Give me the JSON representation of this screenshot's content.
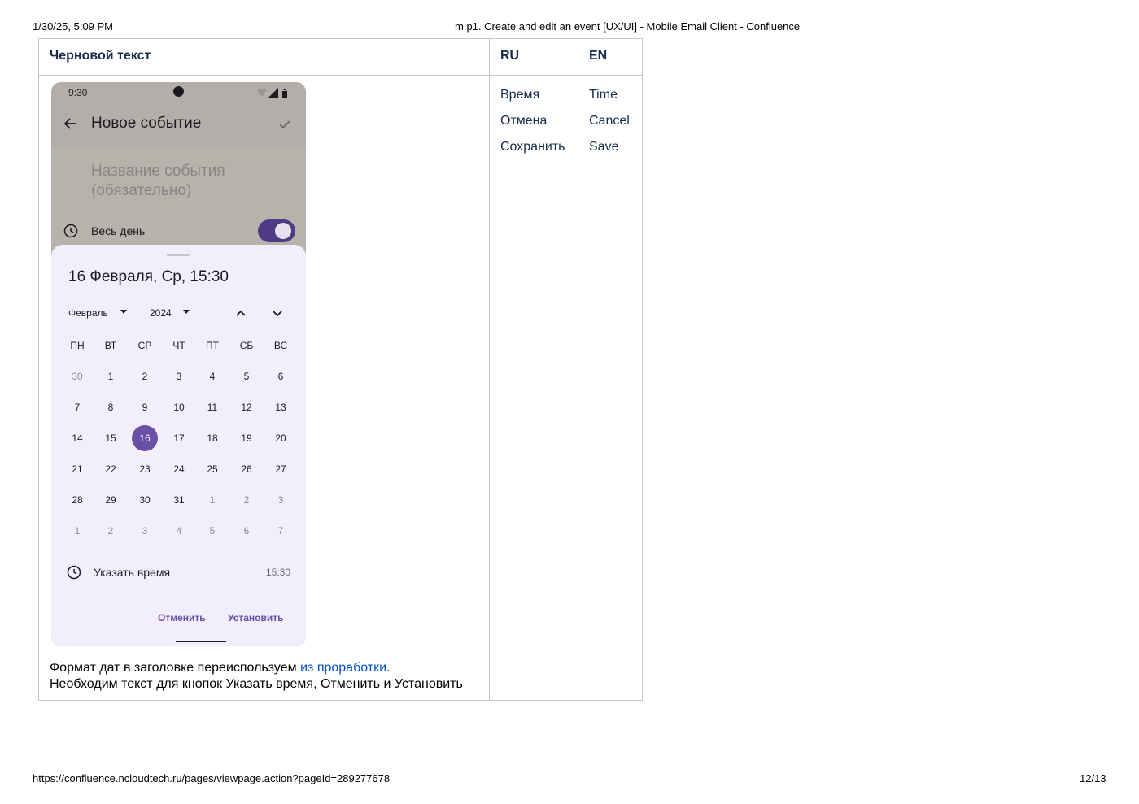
{
  "print_header": {
    "datetime": "1/30/25, 5:09 PM",
    "page_title": "m.p1. Create and edit an event [UX/UI] - Mobile Email Client - Confluence"
  },
  "print_footer": {
    "url": "https://confluence.ncloudtech.ru/pages/viewpage.action?pageId=289277678",
    "page_number": "12/13"
  },
  "table": {
    "headers": {
      "draft": "Черновой текст",
      "ru": "RU",
      "en": "EN"
    },
    "ru_terms": [
      "Время",
      "Отмена",
      "Сохранить"
    ],
    "en_terms": [
      "Time",
      "Cancel",
      "Save"
    ],
    "note_line1_prefix": "Формат дат в заголовке переиспользуем ",
    "note_link": "из проработки",
    "note_line1_suffix": ".",
    "note_line2": "Необходим текст для кнопок Указать время, Отменить и Установить"
  },
  "phone": {
    "status_time": "9:30",
    "appbar_title": "Новое событие",
    "event_name_placeholder": "Название события (обязательно)",
    "all_day_label": "Весь день",
    "all_day_enabled": true,
    "selected_date_header": "16 Февраля, Ср, 15:30",
    "month": "Февраль",
    "year": "2024",
    "weekdays": [
      "ПН",
      "ВТ",
      "СР",
      "ЧТ",
      "ПТ",
      "СБ",
      "ВС"
    ],
    "weeks": [
      [
        "30",
        "1",
        "2",
        "3",
        "4",
        "5",
        "6"
      ],
      [
        "7",
        "8",
        "9",
        "10",
        "11",
        "12",
        "13"
      ],
      [
        "14",
        "15",
        "16",
        "17",
        "18",
        "19",
        "20"
      ],
      [
        "21",
        "22",
        "23",
        "24",
        "25",
        "26",
        "27"
      ],
      [
        "28",
        "29",
        "30",
        "31",
        "1",
        "2",
        "3"
      ],
      [
        "1",
        "2",
        "3",
        "4",
        "5",
        "6",
        "7"
      ]
    ],
    "selected_day": "16",
    "set_time_label": "Указать время",
    "time_value": "15:30",
    "cancel_button": "Отменить",
    "set_button": "Установить",
    "accent_color": "#6a4fa7"
  }
}
